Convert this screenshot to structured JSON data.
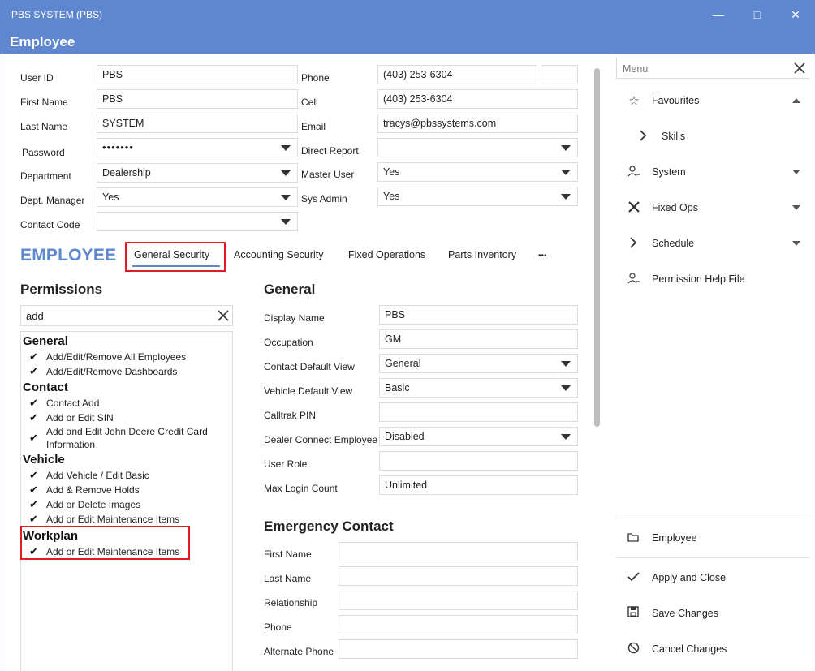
{
  "window": {
    "title": "PBS SYSTEM (PBS)",
    "minimize": "—",
    "maximize": "□",
    "close": "✕"
  },
  "header": {
    "title": "Employee"
  },
  "form": {
    "user_id": {
      "label": "User ID",
      "value": "PBS"
    },
    "first_name": {
      "label": "First Name",
      "value": "PBS"
    },
    "last_name": {
      "label": "Last Name",
      "value": "SYSTEM"
    },
    "password": {
      "label": "Password",
      "value": "•••••••"
    },
    "department": {
      "label": "Department",
      "value": "Dealership"
    },
    "dept_manager": {
      "label": "Dept. Manager",
      "value": "Yes"
    },
    "contact_code": {
      "label": "Contact Code",
      "value": ""
    },
    "phone": {
      "label": "Phone",
      "value": "(403) 253-6304",
      "ext": ""
    },
    "cell": {
      "label": "Cell",
      "value": "(403) 253-6304"
    },
    "email": {
      "label": "Email",
      "value": "tracys@pbssystems.com"
    },
    "direct_report": {
      "label": "Direct Report",
      "value": ""
    },
    "master_user": {
      "label": "Master User",
      "value": "Yes"
    },
    "sys_admin": {
      "label": "Sys Admin",
      "value": "Yes"
    }
  },
  "tabs": {
    "heading": "EMPLOYEE",
    "items": [
      "General Security",
      "Accounting Security",
      "Fixed Operations",
      "Parts Inventory"
    ],
    "more": "•••"
  },
  "permissions": {
    "title": "Permissions",
    "search_value": "add",
    "groups": [
      {
        "name": "General",
        "items": [
          "Add/Edit/Remove All Employees",
          "Add/Edit/Remove Dashboards"
        ]
      },
      {
        "name": "Contact",
        "items": [
          "Contact Add",
          "Add or Edit SIN",
          "Add and Edit John Deere Credit Card",
          "Information"
        ]
      },
      {
        "name": "Vehicle",
        "items": [
          "Add Vehicle / Edit Basic",
          "Add & Remove Holds",
          "Add or Delete Images",
          "Add or Edit Maintenance Items"
        ]
      },
      {
        "name": "Workplan",
        "items": [
          "Add or Edit Maintenance Items"
        ]
      }
    ]
  },
  "general": {
    "title": "General",
    "display_name": {
      "label": "Display Name",
      "value": "PBS"
    },
    "occupation": {
      "label": "Occupation",
      "value": "GM"
    },
    "contact_default_view": {
      "label": "Contact Default View",
      "value": "General"
    },
    "vehicle_default_view": {
      "label": "Vehicle Default View",
      "value": "Basic"
    },
    "calltrak_pin": {
      "label": "Calltrak PIN",
      "value": ""
    },
    "dealer_connect": {
      "label": "Dealer Connect Employee",
      "value": "Disabled"
    },
    "user_role": {
      "label": "User Role",
      "value": ""
    },
    "max_login": {
      "label": "Max Login Count",
      "value": "Unlimited"
    }
  },
  "emergency": {
    "title": "Emergency Contact",
    "first_name": "First Name",
    "last_name": "Last Name",
    "relationship": "Relationship",
    "phone": "Phone",
    "alternate_phone": "Alternate Phone"
  },
  "menu": {
    "placeholder": "Menu",
    "items": [
      "Favourites",
      "Skills",
      "System",
      "Fixed Ops",
      "Schedule",
      "Permission Help File"
    ],
    "bottom": [
      "Employee",
      "Apply and Close",
      "Save Changes",
      "Cancel Changes"
    ]
  },
  "colors": {
    "accent": "#5e87cf",
    "highlight": "#e01b24"
  }
}
